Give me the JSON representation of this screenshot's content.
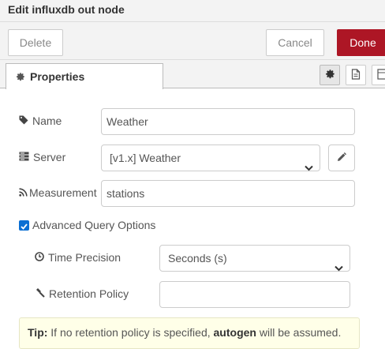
{
  "dialog": {
    "title": "Edit influxdb out node"
  },
  "toolbar": {
    "delete_label": "Delete",
    "cancel_label": "Cancel",
    "done_label": "Done"
  },
  "tabs": {
    "properties_label": "Properties",
    "icons": [
      "gear-icon",
      "document-icon",
      "layout-icon"
    ]
  },
  "form": {
    "name": {
      "label": "Name",
      "value": "Weather"
    },
    "server": {
      "label": "Server",
      "value": "[v1.x] Weather"
    },
    "measurement": {
      "label": "Measurement",
      "value": "stations"
    },
    "advanced": {
      "label": "Advanced Query Options",
      "checked": true
    },
    "time_precision": {
      "label": "Time Precision",
      "value": "Seconds (s)"
    },
    "retention_policy": {
      "label": "Retention Policy",
      "value": ""
    }
  },
  "tip": {
    "prefix": "Tip:",
    "text_before": " If no retention policy is specified, ",
    "highlight": "autogen",
    "text_after": " will be assumed."
  },
  "colors": {
    "primary": "#ad1625",
    "checkbox": "#0b6fd3",
    "tip_background": "#ffffe8"
  }
}
